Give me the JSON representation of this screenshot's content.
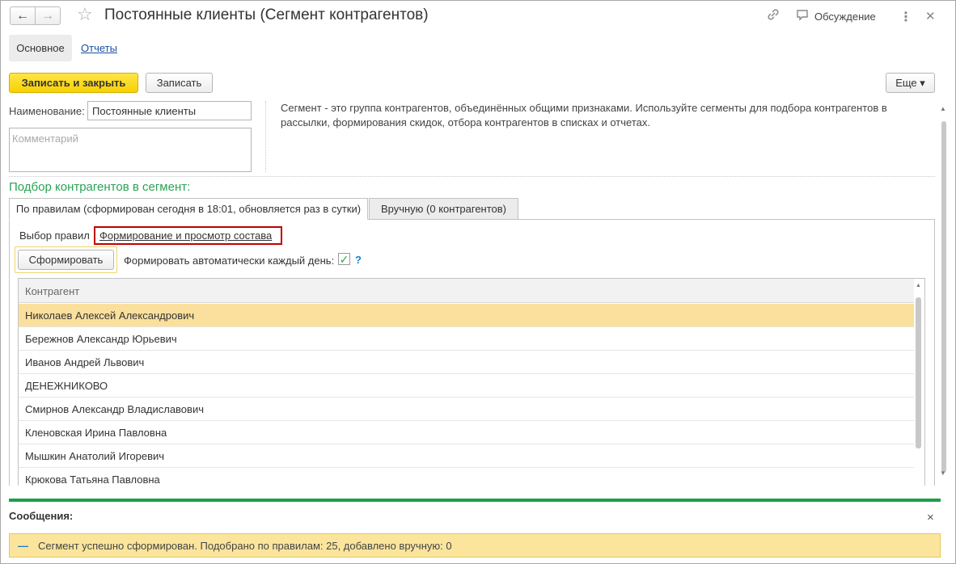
{
  "header": {
    "back_icon": "←",
    "forward_icon": "→",
    "star_icon": "☆",
    "title": "Постоянные клиенты (Сегмент контрагентов)",
    "link_icon": "⊘",
    "discuss_icon": "▭",
    "discuss_label": "Обсуждение",
    "more_icon": "⋮",
    "close_icon": "✕"
  },
  "nav_tabs": {
    "main": "Основное",
    "reports": "Отчеты"
  },
  "toolbar": {
    "save_close": "Записать и закрыть",
    "save": "Записать",
    "more": "Еще ▾"
  },
  "form": {
    "name_label": "Наименование:",
    "name_value": "Постоянные клиенты",
    "comment_placeholder": "Комментарий",
    "description": "Сегмент - это группа контрагентов, объединённых общими признаками. Используйте сегменты для подбора контрагентов в рассылки, формирования скидок, отбора контрагентов в списках и отчетах."
  },
  "section": {
    "title": "Подбор контрагентов в сегмент:",
    "tab_rules": "По правилам (сформирован сегодня в 18:01, обновляется раз в сутки)",
    "tab_manual": "Вручную (0 контрагентов)",
    "rules_label": "Выбор правил",
    "rules_link": "Формирование и просмотр состава",
    "form_button": "Сформировать",
    "auto_label": "Формировать автоматически каждый день:",
    "auto_checked": "✓",
    "help": "?"
  },
  "table": {
    "header": "Контрагент",
    "rows": [
      "Николаев Алексей Александрович",
      "Бережнов Александр Юрьевич",
      "Иванов Андрей Львович",
      "ДЕНЕЖНИКОВО",
      "Смирнов Александр Владиславович",
      "Кленовская Ирина Павловна",
      "Мышкин Анатолий Игоревич",
      "Крюкова Татьяна Павловна"
    ],
    "selected_index": 0
  },
  "messages": {
    "title": "Сообщения:",
    "close_icon": "×",
    "dash": "—",
    "text": "Сегмент успешно сформирован. Подобрано по правилам: 25, добавлено вручную: 0"
  },
  "colors": {
    "accent_yellow": "#f7d100",
    "green": "#1aa04a",
    "selected_row": "#fbe09d",
    "highlight_red": "#c00000"
  }
}
